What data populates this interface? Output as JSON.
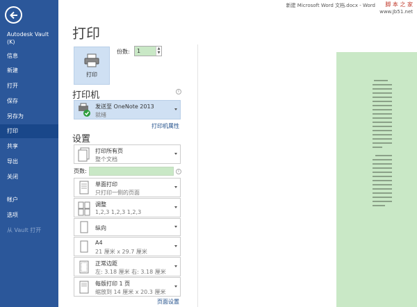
{
  "window": {
    "title": "新建 Microsoft Word 文档.docx - Word",
    "watermark_name": "脚 本 之 家",
    "watermark_url": "www.Jb51.net"
  },
  "sidebar": {
    "vault_title": "Autodesk Vault (K)",
    "items": [
      {
        "label": "信息"
      },
      {
        "label": "新建"
      },
      {
        "label": "打开"
      },
      {
        "label": "保存"
      },
      {
        "label": "另存为"
      },
      {
        "label": "打印"
      },
      {
        "label": "共享"
      },
      {
        "label": "导出"
      },
      {
        "label": "关闭"
      },
      {
        "label": "帐户"
      },
      {
        "label": "选项"
      },
      {
        "label": "从 Vault 打开"
      }
    ],
    "active_item": "打印"
  },
  "print": {
    "page_title": "打印",
    "button_label": "打印",
    "copies_label": "份数:",
    "copies_value": "1"
  },
  "printer": {
    "heading": "打印机",
    "name": "发送至 OneNote 2013",
    "status": "就绪",
    "properties_link": "打印机属性"
  },
  "settings": {
    "heading": "设置",
    "range_title": "打印所有页",
    "range_sub": "整个文档",
    "pages_label": "页数:",
    "pages_value": "",
    "sides_title": "单面打印",
    "sides_sub": "只打印一侧的页面",
    "collate_title": "调整",
    "collate_sub": "1,2,3     1,2,3     1,2,3",
    "orientation_title": "纵向",
    "paper_title": "A4",
    "paper_sub": "21 厘米 x 29.7 厘米",
    "margins_title": "正常边距",
    "margins_sub": "左: 3.18 厘米    右: 3.18 厘米",
    "per_sheet_title": "每版打印 1 页",
    "per_sheet_sub": "缩放到 14 厘米 x 20.3 厘米",
    "page_setup_link": "页面设置"
  },
  "colors": {
    "sidebar_bg": "#2b579a",
    "sidebar_active": "#19478a",
    "accent_light": "#cfe0f3",
    "green_fill": "#c9e8c6"
  }
}
